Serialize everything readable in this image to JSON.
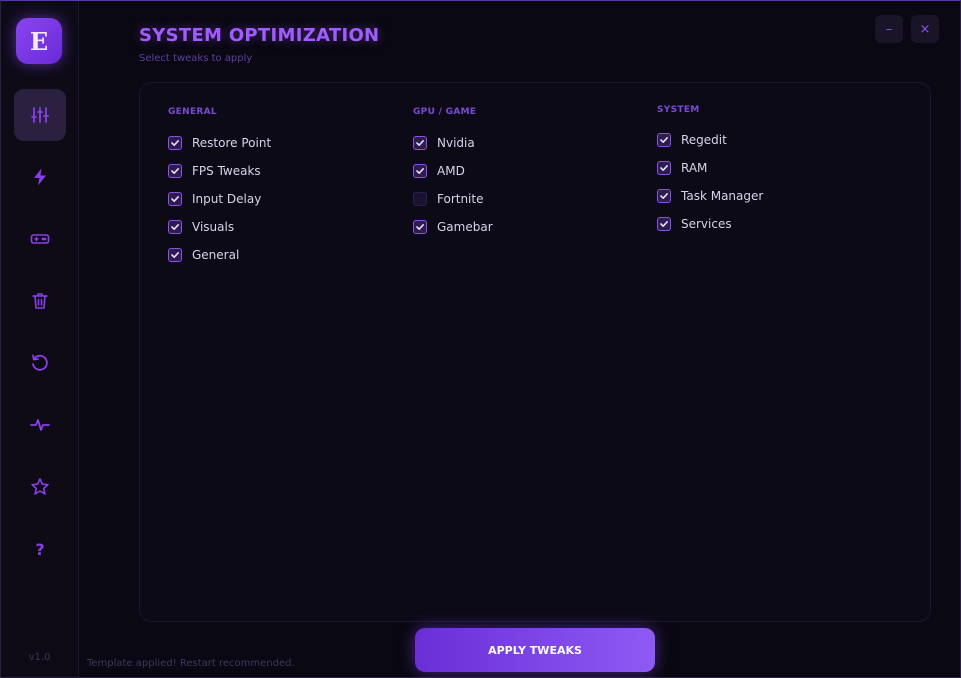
{
  "logo": {
    "glyph": "E"
  },
  "sidebar": {
    "items": [
      {
        "icon": "sliders-icon",
        "active": true
      },
      {
        "icon": "lightning-icon",
        "active": false
      },
      {
        "icon": "gamepad-icon",
        "active": false
      },
      {
        "icon": "trash-icon",
        "active": false
      },
      {
        "icon": "restore-icon",
        "active": false
      },
      {
        "icon": "pulse-icon",
        "active": false
      },
      {
        "icon": "star-icon",
        "active": false
      },
      {
        "icon": "help-icon",
        "active": false,
        "glyph": "?"
      }
    ],
    "version": "v1.0"
  },
  "header": {
    "title": "SYSTEM OPTIMIZATION",
    "subtitle": "Select tweaks to apply",
    "minimize_glyph": "–",
    "close_glyph": "×"
  },
  "columns": [
    {
      "header": "GENERAL",
      "options": [
        {
          "label": "Restore Point",
          "checked": true
        },
        {
          "label": "FPS Tweaks",
          "checked": true
        },
        {
          "label": "Input Delay",
          "checked": true
        },
        {
          "label": "Visuals",
          "checked": true
        },
        {
          "label": "General",
          "checked": true
        }
      ]
    },
    {
      "header": "GPU / GAME",
      "options": [
        {
          "label": "Nvidia",
          "checked": true
        },
        {
          "label": "AMD",
          "checked": true
        },
        {
          "label": "Fortnite",
          "checked": false
        },
        {
          "label": "Gamebar",
          "checked": true
        }
      ]
    },
    {
      "header": "SYSTEM",
      "options": [
        {
          "label": "Regedit",
          "checked": true
        },
        {
          "label": "RAM",
          "checked": true
        },
        {
          "label": "Task Manager",
          "checked": true
        },
        {
          "label": "Services",
          "checked": true
        }
      ]
    }
  ],
  "apply_button": "APPLY TWEAKS",
  "status_text": "Template applied! Restart recommended.",
  "colors": {
    "accent": "#8b3fe8",
    "title": "#a05cff",
    "background": "#0a0812"
  }
}
